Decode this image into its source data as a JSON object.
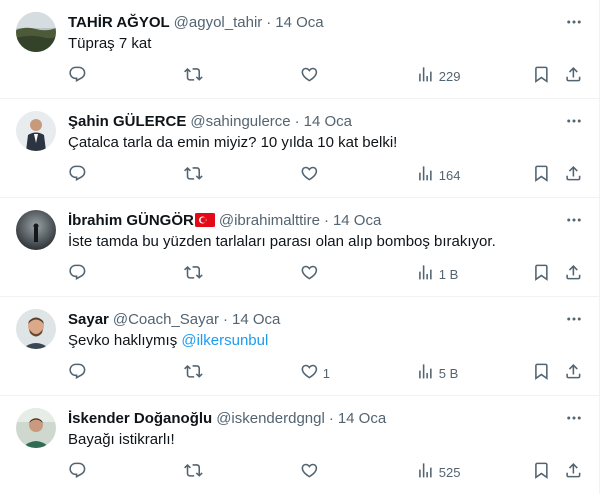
{
  "tweets": [
    {
      "name": "TAHİR AĞYOL",
      "handle": "@agyol_tahir",
      "time": "14 Oca",
      "text": "Tüpraş 7 kat",
      "mention": "",
      "likes": "",
      "views": "229",
      "flag": false
    },
    {
      "name": "Şahin GÜLERCE",
      "handle": "@sahingulerce",
      "time": "14 Oca",
      "text": "Çatalca tarla da emin miyiz?  10 yılda 10 kat belki!",
      "mention": "",
      "likes": "",
      "views": "164",
      "flag": false
    },
    {
      "name": "İbrahim GÜNGÖR",
      "handle": "@ibrahimalttire",
      "time": "14 Oca",
      "text": "İste tamda bu yüzden tarlaları parası olan alıp bomboş bırakıyor.",
      "mention": "",
      "likes": "",
      "views": "1 B",
      "flag": true
    },
    {
      "name": "Sayar",
      "handle": "@Coach_Sayar",
      "time": "14 Oca",
      "text": "Şevko haklıymış ",
      "mention": "@ilkersunbul",
      "likes": "1",
      "views": "5 B",
      "flag": false
    },
    {
      "name": "İskender Doğanoğlu",
      "handle": "@iskenderdgngl",
      "time": "14 Oca",
      "text": "Bayağı istikrarlı!",
      "mention": "",
      "likes": "",
      "views": "525",
      "flag": false
    }
  ],
  "icons": {
    "reply": "reply-icon",
    "retweet": "retweet-icon",
    "like": "like-icon",
    "views": "views-icon",
    "bookmark": "bookmark-icon",
    "share": "share-icon",
    "more": "more-icon"
  },
  "colors": {
    "accent": "#1d9bf0",
    "secondary_text": "#536471",
    "divider": "#eff3f4"
  }
}
